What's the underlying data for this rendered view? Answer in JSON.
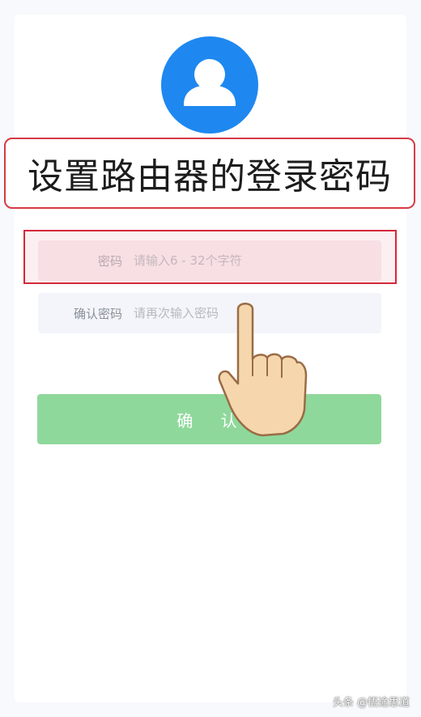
{
  "banner": {
    "title": "设置路由器的登录密码"
  },
  "form": {
    "password": {
      "label": "密码",
      "placeholder": "请输入6 - 32个字符"
    },
    "confirm_password": {
      "label": "确认密码",
      "placeholder": "请再次输入密码"
    },
    "submit_label": "确 认"
  },
  "watermark": "头条 @悟途思道",
  "icons": {
    "avatar": "user-avatar-icon",
    "pointer": "pointing-hand-icon"
  },
  "colors": {
    "avatar_bg": "#1e88f0",
    "button_bg": "#8fd89b",
    "highlight_border": "#d5283a"
  }
}
